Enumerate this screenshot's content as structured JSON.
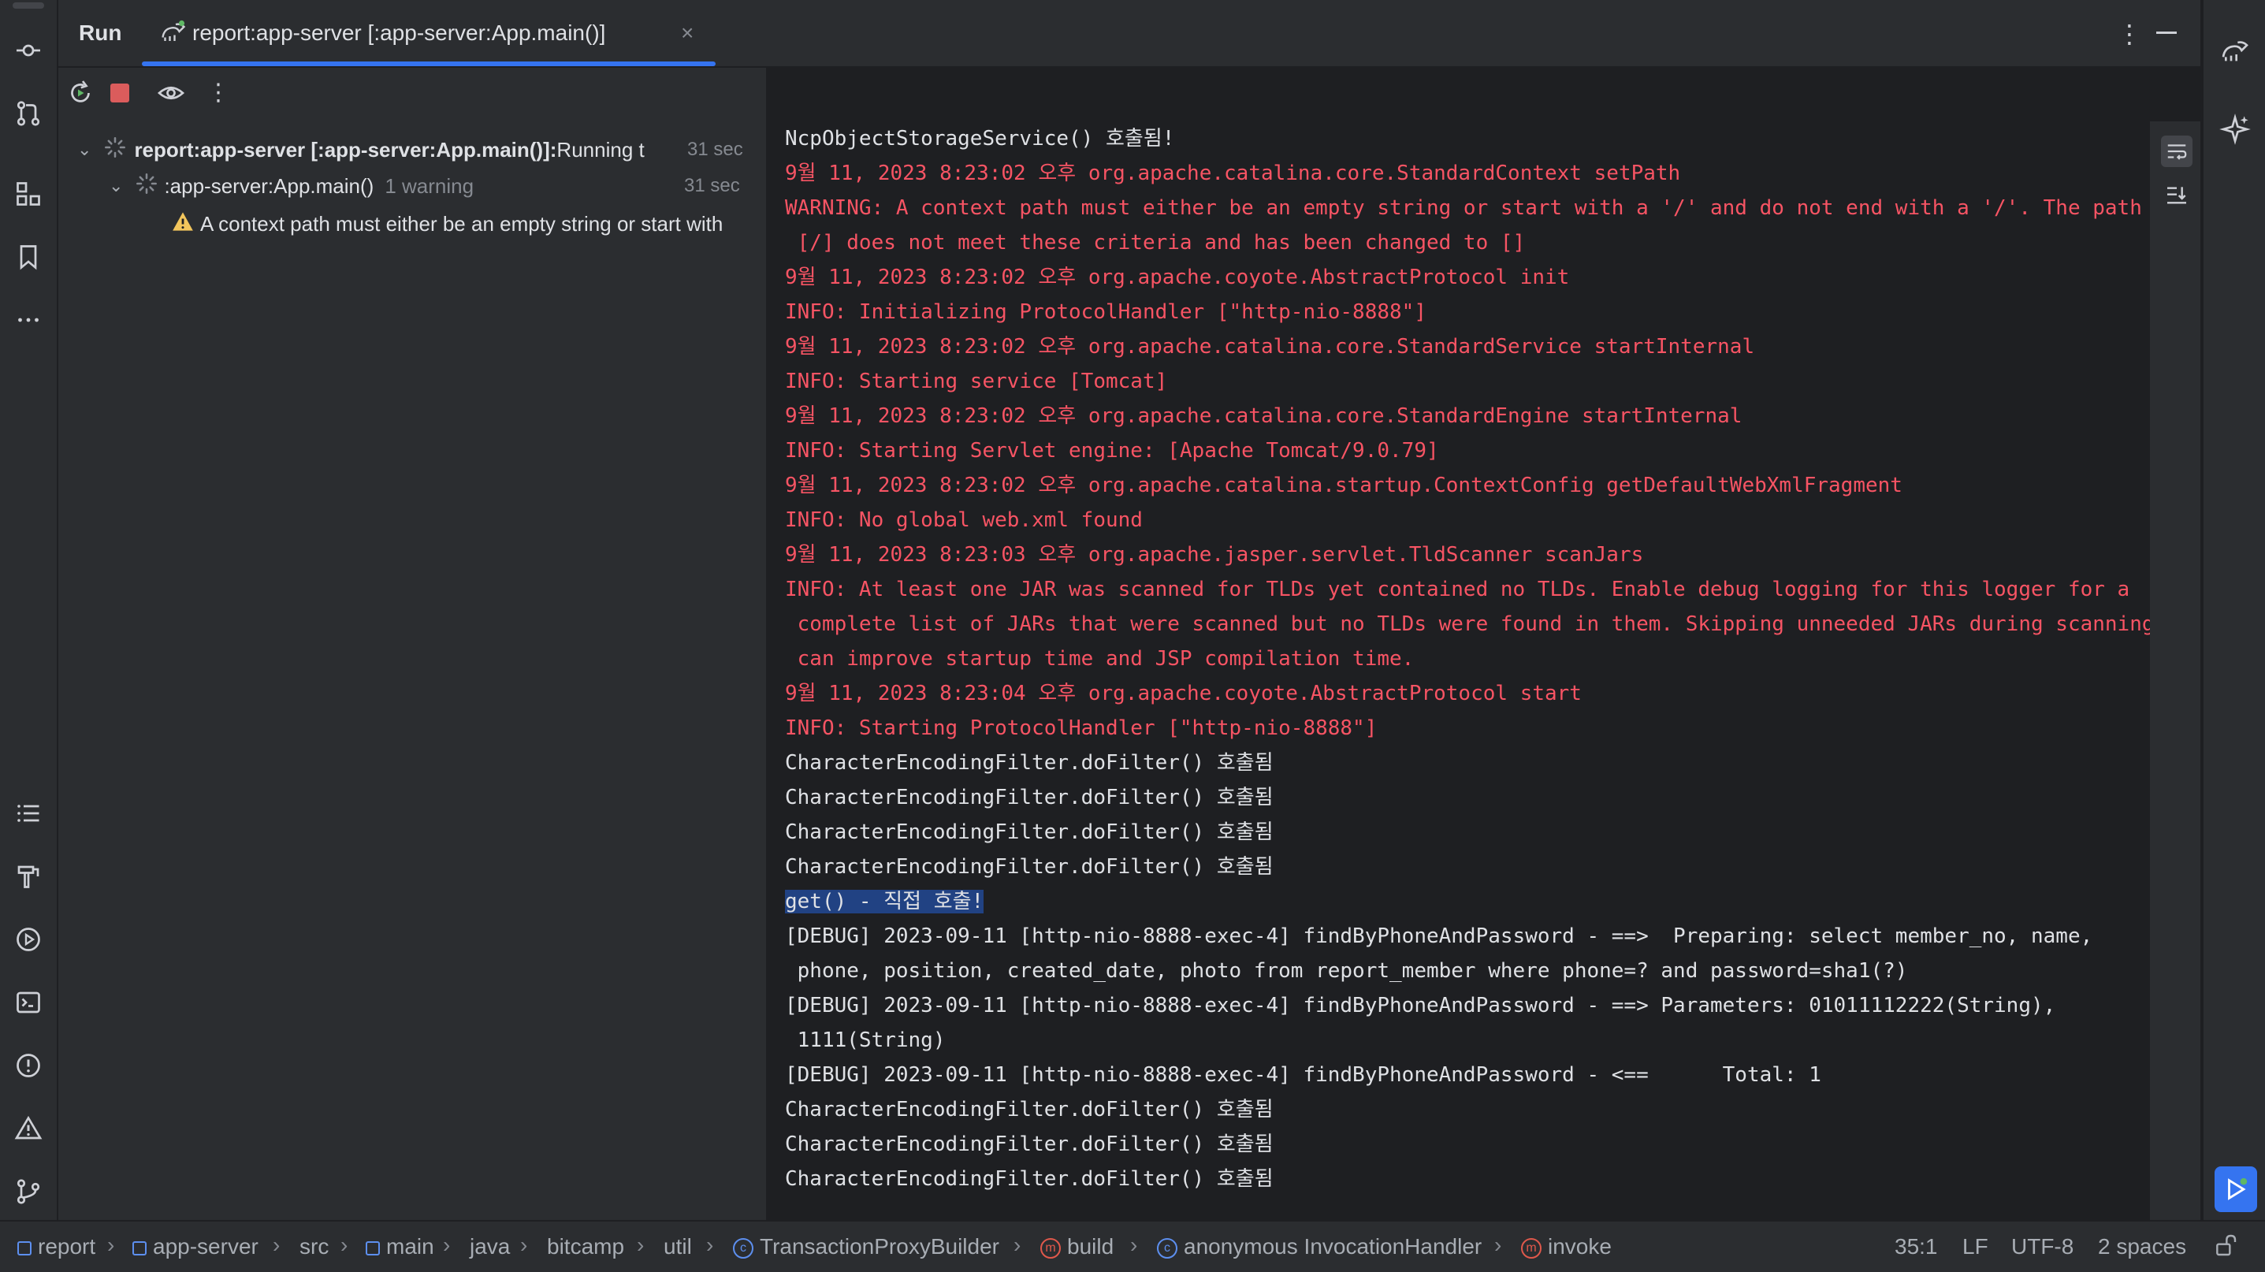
{
  "header": {
    "run_label": "Run",
    "tab_label": "report:app-server [:app-server:App.main()]",
    "tab_close": "×",
    "more": "⋮"
  },
  "tree": {
    "root_label": "report:app-server [:app-server:App.main()]:",
    "root_status": " Running t",
    "root_time": "31 sec",
    "child_label": ":app-server:App.main()",
    "child_warning": "1 warning",
    "child_time": "31 sec",
    "warning_message": "A context path must either be an empty string or start with"
  },
  "console": {
    "lines": [
      {
        "text": "NcpObjectStorageService() 호출됨!",
        "style": "norm"
      },
      {
        "text": "9월 11, 2023 8:23:02 오후 org.apache.catalina.core.StandardContext setPath",
        "style": "red"
      },
      {
        "text": "WARNING: A context path must either be an empty string or start with a '/' and do not end with a '/'. The path",
        "style": "red"
      },
      {
        "text": " [/] does not meet these criteria and has been changed to []",
        "style": "red"
      },
      {
        "text": "9월 11, 2023 8:23:02 오후 org.apache.coyote.AbstractProtocol init",
        "style": "red"
      },
      {
        "text": "INFO: Initializing ProtocolHandler [\"http-nio-8888\"]",
        "style": "red"
      },
      {
        "text": "9월 11, 2023 8:23:02 오후 org.apache.catalina.core.StandardService startInternal",
        "style": "red"
      },
      {
        "text": "INFO: Starting service [Tomcat]",
        "style": "red"
      },
      {
        "text": "9월 11, 2023 8:23:02 오후 org.apache.catalina.core.StandardEngine startInternal",
        "style": "red"
      },
      {
        "text": "INFO: Starting Servlet engine: [Apache Tomcat/9.0.79]",
        "style": "red"
      },
      {
        "text": "9월 11, 2023 8:23:02 오후 org.apache.catalina.startup.ContextConfig getDefaultWebXmlFragment",
        "style": "red"
      },
      {
        "text": "INFO: No global web.xml found",
        "style": "red"
      },
      {
        "text": "9월 11, 2023 8:23:03 오후 org.apache.jasper.servlet.TldScanner scanJars",
        "style": "red"
      },
      {
        "text": "INFO: At least one JAR was scanned for TLDs yet contained no TLDs. Enable debug logging for this logger for a",
        "style": "red"
      },
      {
        "text": " complete list of JARs that were scanned but no TLDs were found in them. Skipping unneeded JARs during scanning",
        "style": "red"
      },
      {
        "text": " can improve startup time and JSP compilation time.",
        "style": "red"
      },
      {
        "text": "9월 11, 2023 8:23:04 오후 org.apache.coyote.AbstractProtocol start",
        "style": "red"
      },
      {
        "text": "INFO: Starting ProtocolHandler [\"http-nio-8888\"]",
        "style": "red"
      },
      {
        "text": "CharacterEncodingFilter.doFilter() 호출됨",
        "style": "norm"
      },
      {
        "text": "CharacterEncodingFilter.doFilter() 호출됨",
        "style": "norm"
      },
      {
        "text": "CharacterEncodingFilter.doFilter() 호출됨",
        "style": "norm"
      },
      {
        "text": "CharacterEncodingFilter.doFilter() 호출됨",
        "style": "norm"
      },
      {
        "text": "get() - 직접 호출!",
        "style": "sel"
      },
      {
        "text": "[DEBUG] 2023-09-11 [http-nio-8888-exec-4] findByPhoneAndPassword - ==>  Preparing: select member_no, name,",
        "style": "norm"
      },
      {
        "text": " phone, position, created_date, photo from report_member where phone=? and password=sha1(?)",
        "style": "norm"
      },
      {
        "text": "[DEBUG] 2023-09-11 [http-nio-8888-exec-4] findByPhoneAndPassword - ==> Parameters: 01011112222(String),",
        "style": "norm"
      },
      {
        "text": " 1111(String)",
        "style": "norm"
      },
      {
        "text": "[DEBUG] 2023-09-11 [http-nio-8888-exec-4] findByPhoneAndPassword - <==      Total: 1",
        "style": "norm"
      },
      {
        "text": "CharacterEncodingFilter.doFilter() 호출됨",
        "style": "norm"
      },
      {
        "text": "CharacterEncodingFilter.doFilter() 호출됨",
        "style": "norm"
      },
      {
        "text": "CharacterEncodingFilter.doFilter() 호출됨",
        "style": "norm"
      }
    ]
  },
  "breadcrumbs": [
    "report",
    "app-server",
    "src",
    "main",
    "java",
    "bitcamp",
    "util",
    "TransactionProxyBuilder",
    "build",
    "anonymous InvocationHandler",
    "invoke"
  ],
  "status": {
    "position": "35:1",
    "line_sep": "LF",
    "encoding": "UTF-8",
    "indent": "2 spaces"
  },
  "colors": {
    "accent": "#3574f0",
    "error_text": "#f75464",
    "selection": "#214283",
    "warning": "#f2c55c"
  },
  "icons": [
    "commit-icon",
    "pull-requests-icon",
    "structure-icon",
    "bookmarks-icon",
    "more-icon",
    "todo-icon",
    "build-icon",
    "services-icon",
    "terminal-icon",
    "problems-icon",
    "warning-icon",
    "git-icon",
    "rerun-icon",
    "stop-icon",
    "eye-icon",
    "gradle-icon",
    "ai-assistant-icon",
    "soft-wrap-icon",
    "scroll-to-end-icon",
    "run-icon",
    "lock-icon"
  ]
}
